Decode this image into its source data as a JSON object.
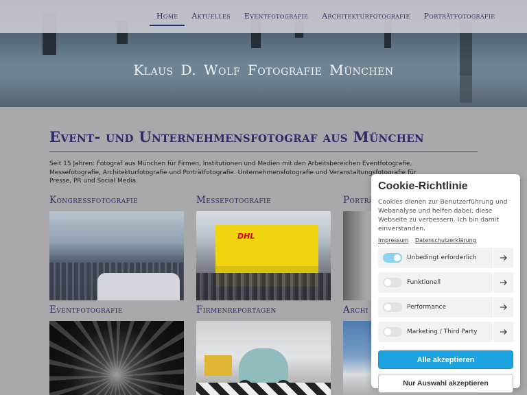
{
  "nav": {
    "items": [
      {
        "label": "Home",
        "active": true
      },
      {
        "label": "Aktuelles",
        "active": false
      },
      {
        "label": "Eventfotografie",
        "active": false
      },
      {
        "label": "Architekturfotografie",
        "active": false
      },
      {
        "label": "Porträtfotografie",
        "active": false
      }
    ]
  },
  "hero": {
    "title": "Klaus D. Wolf  Fotografie  München"
  },
  "main": {
    "title": "Event- und Unternehmensfotograf aus München",
    "intro": "Seit 15 Jahren: Fotograf aus München für Firmen, Institutionen und Medien mit den Arbeitsbereichen Eventfotografie, Messefotografie, Architekturfotografie und Porträtfotografie. Unternehmensfotografie und Veranstaltungsfotografie für Presse, PR und Social Media."
  },
  "gallery": [
    {
      "label": "Kongressfotografie"
    },
    {
      "label": "Messefotografie"
    },
    {
      "label": "Porträt"
    },
    {
      "label": "Eventfotografie"
    },
    {
      "label": "Firmenreportagen"
    },
    {
      "label": "Archi"
    }
  ],
  "images": {
    "messe_sign": "DHL"
  },
  "cookie": {
    "title": "Cookie-Richtlinie",
    "text": "Cookies dienen zur Benutzerführung und Webanalyse und helfen dabei, diese Webseite zu verbessern. Ich bin damit einverstanden.",
    "links": {
      "impressum": "Impressum",
      "datenschutz": "Datenschutzerklärung"
    },
    "options": [
      {
        "label": "Unbedingt erforderlich",
        "enabled": true
      },
      {
        "label": "Funktionell",
        "enabled": false
      },
      {
        "label": "Performance",
        "enabled": false
      },
      {
        "label": "Marketing / Third Party",
        "enabled": false
      }
    ],
    "accept_all": "Alle akzeptieren",
    "accept_selection": "Nur Auswahl akzeptieren",
    "accent_color": "#1aa3e0"
  }
}
